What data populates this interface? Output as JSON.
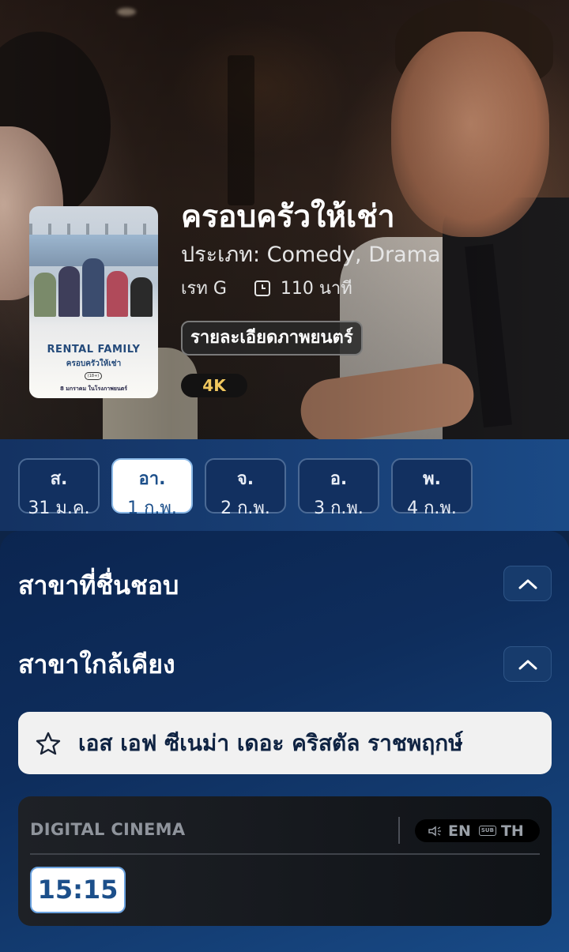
{
  "movie": {
    "title": "ครอบครัวให้เช่า",
    "genre": "ประเภท: Comedy, Drama",
    "rating": "เรท G",
    "duration": "110 นาที",
    "details_button": "รายละเอียดภาพยนตร์",
    "format_badge": "4K",
    "poster": {
      "title_en": "RENTAL FAMILY",
      "title_th": "ครอบครัวให้เช่า",
      "release": "8 มกราคม ในโรงภาพยนตร์",
      "rating_mark": "(18+)"
    }
  },
  "dates": [
    {
      "dow": "ส.",
      "date": "31 ม.ค.",
      "active": false
    },
    {
      "dow": "อา.",
      "date": "1 ก.พ.",
      "active": true
    },
    {
      "dow": "จ.",
      "date": "2 ก.พ.",
      "active": false
    },
    {
      "dow": "อ.",
      "date": "3 ก.พ.",
      "active": false
    },
    {
      "dow": "พ.",
      "date": "4 ก.พ.",
      "active": false
    }
  ],
  "sections": {
    "favorite_branches": "สาขาที่ชื่นชอบ",
    "nearby_branches": "สาขาใกล้เคียง"
  },
  "branch": {
    "name": "เอส เอฟ ซีเนม่า เดอะ คริสตัล ราชพฤกษ์"
  },
  "showtime": {
    "system": "DIGITAL CINEMA",
    "audio": "EN",
    "subtitle_tag": "SUB",
    "subtitle": "TH",
    "times": [
      "15:15"
    ]
  },
  "colors": {
    "accent": "#1c4f8a",
    "badge_4k": "#f0c75e",
    "background": "#0d2447"
  },
  "icons": {
    "clock": "clock-icon",
    "chevron": "chevron-up-icon",
    "star": "star-outline-icon",
    "audio": "speaker-icon"
  }
}
